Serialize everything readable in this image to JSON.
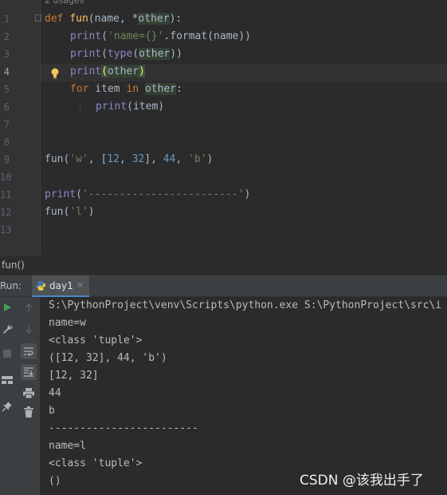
{
  "editor": {
    "usages": "2 usages",
    "line_numbers": [
      "1",
      "2",
      "3",
      "4",
      "5",
      "6",
      "7",
      "8",
      "9",
      "10",
      "11",
      "12",
      "13"
    ],
    "code": {
      "l1": {
        "def": "def",
        "name": "fun",
        "open": "(",
        "p1": "name",
        "mid": ", *",
        "p2": "other",
        "close": "):"
      },
      "l2": {
        "print": "print",
        "open": "(",
        "str": "'name={}'",
        "rest": ".format(name))"
      },
      "l3": {
        "print": "print",
        "open": "(",
        "type": "type",
        "open2": "(",
        "arg": "other",
        "close": "))"
      },
      "l4": {
        "print": "print",
        "open": "(",
        "arg": "other",
        "close": ")"
      },
      "l5": {
        "for": "for",
        "item": " item ",
        "in": "in",
        "sp": " ",
        "arg": "other",
        "colon": ":"
      },
      "l6": {
        "print": "print",
        "rest": "(item)"
      },
      "l9": {
        "fn": "fun(",
        "s1": "'w'",
        "c1": ", [",
        "n1": "12",
        "c2": ", ",
        "n2": "32",
        "c3": "], ",
        "n3": "44",
        "c4": ", ",
        "s2": "'b'",
        "close": ")"
      },
      "l11": {
        "print": "print",
        "open": "(",
        "str": "'------------------------'",
        "close": ")"
      },
      "l12": {
        "fn": "fun(",
        "str": "'l'",
        "close": ")"
      }
    }
  },
  "breadcrumb": {
    "label": "fun()"
  },
  "run": {
    "label": "Run:",
    "tab_label": "day1",
    "tab_close": "×",
    "output": [
      "S:\\PythonProject\\venv\\Scripts\\python.exe S:\\PythonProject\\src\\i",
      "name=w",
      "<class 'tuple'>",
      "([12, 32], 44, 'b')",
      "[12, 32]",
      "44",
      "b",
      "------------------------",
      "name=l",
      "<class 'tuple'>",
      "()"
    ]
  },
  "watermark": "CSDN @该我出手了",
  "colors": {
    "keyword": "#cc7832",
    "function": "#ffc66d",
    "string": "#6a8759",
    "number": "#6897bb",
    "builtin": "#8888c6",
    "run_green": "#499c54"
  }
}
